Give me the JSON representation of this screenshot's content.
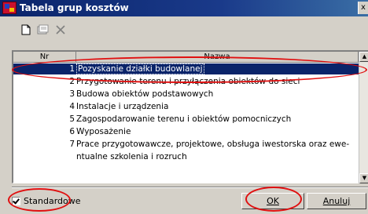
{
  "window": {
    "title": "Tabela grup kosztów",
    "close_glyph": "x"
  },
  "toolbar": {
    "icons": [
      "new-document-icon",
      "properties-icon",
      "delete-icon"
    ]
  },
  "table": {
    "columns": [
      "Nr",
      "Nazwa"
    ],
    "rows": [
      {
        "nr": "1",
        "name": "Pozyskanie działki budowlanej",
        "selected": true
      },
      {
        "nr": "2",
        "name": "Przygotowanie terenu i przyłączenia obiektów do sieci"
      },
      {
        "nr": "3",
        "name": "Budowa obiektów podstawowych"
      },
      {
        "nr": "4",
        "name": "Instalacje i urządzenia"
      },
      {
        "nr": "5",
        "name": "Zagospodarowanie terenu i obiektów pomocniczych"
      },
      {
        "nr": "6",
        "name": "Wyposażenie"
      },
      {
        "nr": "7",
        "name": "Prace przygotowawcze, projektowe, obsługa iwestorska oraz ewe-"
      },
      {
        "nr": "",
        "name": "ntualne szkolenia i rozruch"
      }
    ]
  },
  "footer": {
    "checkbox_label": "Standardowe",
    "checkbox_checked": true,
    "ok_label": "OK",
    "cancel_label": "Anuluj"
  },
  "colors": {
    "highlight_ellipse": "#e01010",
    "selection": "#0a246a"
  }
}
